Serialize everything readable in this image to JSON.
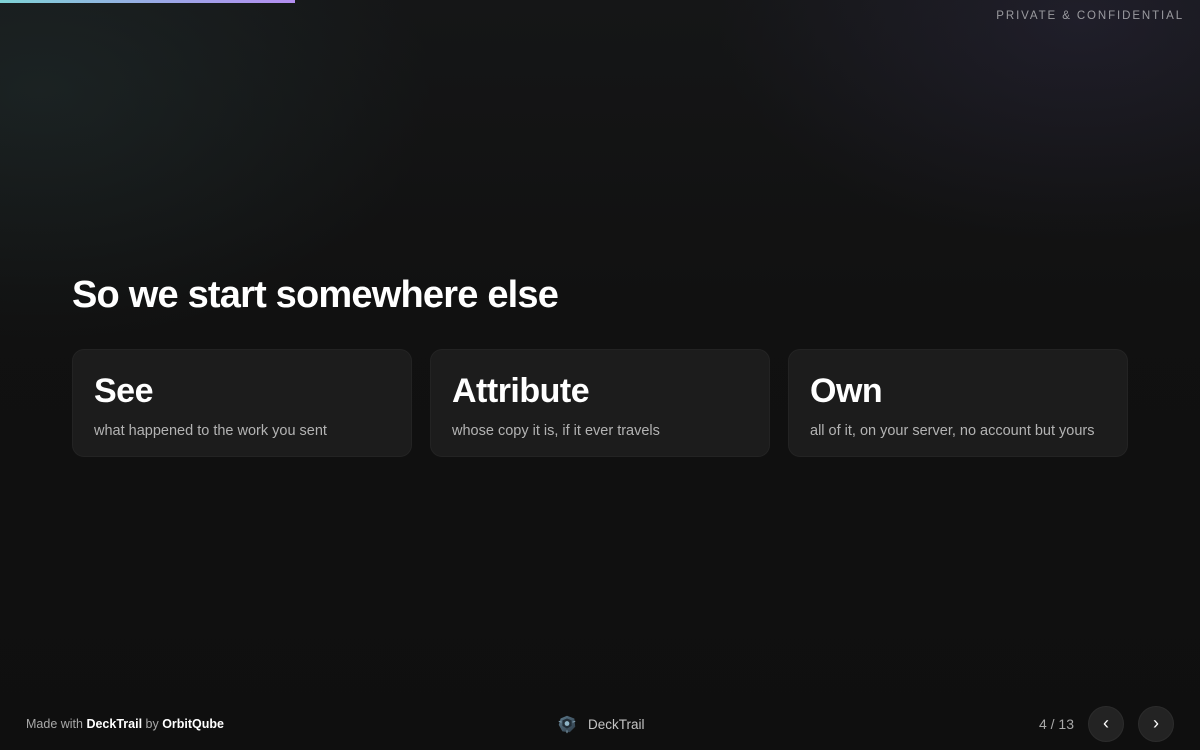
{
  "progress": {
    "current_slide": 4,
    "total_slides": 13,
    "fraction": 0.2462
  },
  "header": {
    "confidential_label": "PRIVATE & CONFIDENTIAL"
  },
  "slide": {
    "heading": "So we start somewhere else",
    "cards": [
      {
        "title": "See",
        "subtitle": "what happened to the work you sent"
      },
      {
        "title": "Attribute",
        "subtitle": "whose copy it is, if it ever travels"
      },
      {
        "title": "Own",
        "subtitle": "all of it, on your server, no account but yours"
      }
    ]
  },
  "footer": {
    "made_with_prefix": "Made with ",
    "product_name": "DeckTrail",
    "by_text": " by ",
    "company_name": "OrbitQube",
    "brand_name": "DeckTrail",
    "brand_icon": "decktrail-logo-icon",
    "page_indicator": "4 / 13",
    "prev_label": "‹",
    "next_label": "›"
  },
  "colors": {
    "background": "#101010",
    "card_background": "#1c1c1c",
    "progress_start": "#7fd3d6",
    "progress_end": "#b48ef0"
  }
}
